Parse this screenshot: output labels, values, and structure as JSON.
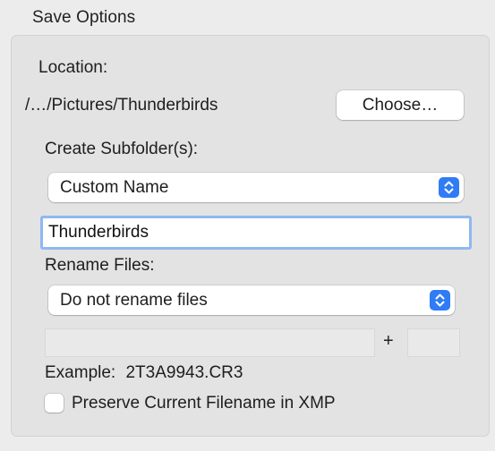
{
  "group": {
    "title": "Save Options"
  },
  "location": {
    "label": "Location:",
    "path": "/…/Pictures/Thunderbirds",
    "choose_label": "Choose…"
  },
  "subfolder": {
    "label": "Create Subfolder(s):",
    "selected": "Custom Name",
    "name_value": "Thunderbirds"
  },
  "rename": {
    "label": "Rename Files:",
    "selected": "Do not rename files",
    "plus_label": "+",
    "example_prefix": "Example:",
    "example_value": "2T3A9943.CR3",
    "preserve_label": "Preserve Current Filename in XMP",
    "preserve_checked": false
  },
  "colors": {
    "accent": "#2f7cf6",
    "focus_ring": "#8fb7f2",
    "panel_bg": "#e3e3e3",
    "window_bg": "#ececec"
  },
  "icons": {
    "popup_arrows": "chevron-up-down-icon"
  }
}
